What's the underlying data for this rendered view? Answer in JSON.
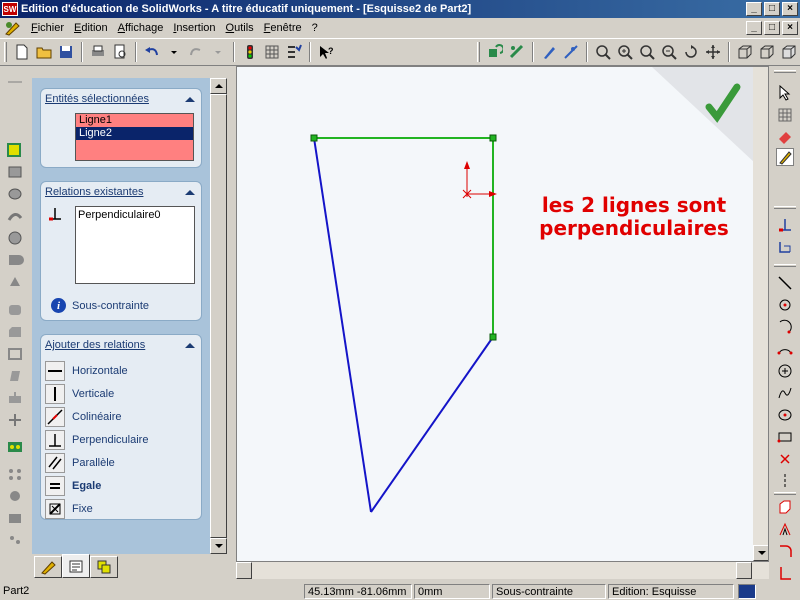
{
  "window": {
    "title": "Edition d'éducation de SolidWorks - A titre éducatif uniquement - [Esquisse2 de Part2]",
    "app_icon_text": "SW",
    "controls": [
      "_",
      "□",
      "×"
    ]
  },
  "menu": {
    "items": [
      "Fichier",
      "Edition",
      "Affichage",
      "Insertion",
      "Outils",
      "Fenêtre",
      "?"
    ]
  },
  "property_manager": {
    "selected_entities": {
      "title": "Entités sélectionnées",
      "items": [
        "Ligne1",
        "Ligne2"
      ],
      "active_index": 1
    },
    "existing_relations": {
      "title": "Relations existantes",
      "items": [
        "Perpendiculaire0"
      ],
      "status": "Sous-contrainte"
    },
    "add_relations": {
      "title": "Ajouter des relations",
      "items": [
        {
          "label": "Horizontale",
          "icon": "horizontal-icon"
        },
        {
          "label": "Verticale",
          "icon": "vertical-icon"
        },
        {
          "label": "Colinéaire",
          "icon": "collinear-icon"
        },
        {
          "label": "Perpendiculaire",
          "icon": "perpendicular-icon"
        },
        {
          "label": "Parallèle",
          "icon": "parallel-icon"
        },
        {
          "label": "Egale",
          "icon": "equal-icon"
        },
        {
          "label": "Fixe",
          "icon": "fix-icon"
        }
      ]
    }
  },
  "viewport": {
    "annotation": [
      "les 2 lignes sont",
      "perpendiculaires"
    ],
    "colors": {
      "sketch_line": "#1414c8",
      "constrained_line": "#22b422",
      "annotation": "#e00000",
      "confirm": "#3a9a3a"
    }
  },
  "status_bar": {
    "part": "Part2",
    "coords": "45.13mm -81.06mm",
    "z": "0mm",
    "constraint": "Sous-contrainte",
    "mode": "Edition: Esquisse"
  }
}
